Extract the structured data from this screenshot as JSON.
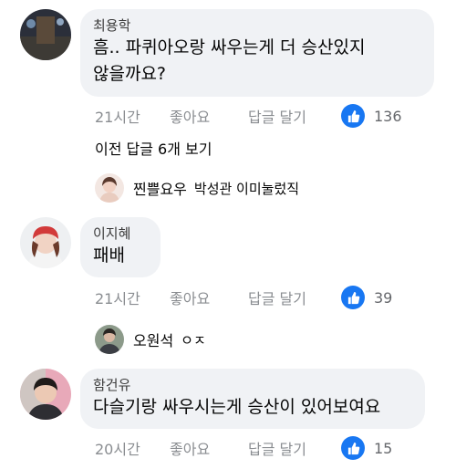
{
  "comments": [
    {
      "author": "최용학",
      "text_line1": "흠.. 파퀴아오랑 싸우는게 더 승산있지",
      "text_line2": "않을까요?",
      "time": "21시간",
      "like_label": "좋아요",
      "reply_label": "답글 달기",
      "reactions": "136"
    },
    {
      "author": "이지혜",
      "text_line1": "패배",
      "time": "21시간",
      "like_label": "좋아요",
      "reply_label": "답글 달기",
      "reactions": "39"
    },
    {
      "author": "함건유",
      "text_line1": "다슬기랑 싸우시는게 승산이 있어보여요",
      "time": "20시간",
      "like_label": "좋아요",
      "reply_label": "답글 달기",
      "reactions": "15"
    }
  ],
  "view_previous": "이전 답글 6개 보기",
  "replies": [
    {
      "name": "찐쁠요우",
      "snippet": "박성관 이미눌렀직"
    },
    {
      "name": "오원석",
      "snippet": "ㅇㅈ"
    }
  ],
  "colors": {
    "bubble": "#f0f2f5",
    "like_blue": "#1877f2",
    "meta_gray": "#8a8d91"
  }
}
